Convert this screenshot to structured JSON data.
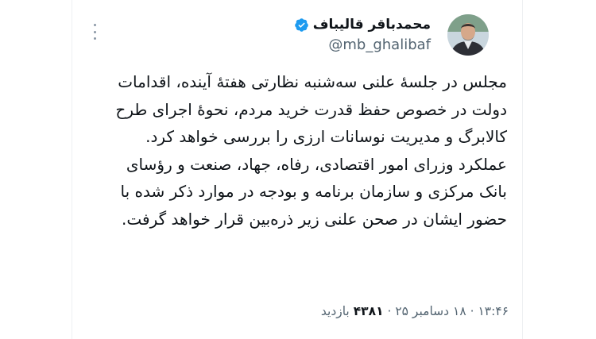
{
  "tweet": {
    "author_name": "محمدباقر قالیباف",
    "author_handle": "@mb_ghalibaf",
    "paragraph_1": "مجلس در جلسهٔ علنی سه‌شنبه نظارتی هفتهٔ آینده، اقدامات دولت در خصوص حفظ قدرت خرید مردم، نحوهٔ اجرای طرح کالابرگ و مدیریت نوسانات ارزی را بررسی خواهد کرد.",
    "paragraph_2": "عملکرد وزرای امور اقتصادی، رفاه، جهاد، صنعت و رؤسای بانک مرکزی و سازمان برنامه و بودجه در موارد ذکر شده با حضور ایشان در صحن علنی زیر ذره‌بین قرار خواهد گرفت.",
    "time": "۱۳:۴۶",
    "date": "۱۸ دسامبر ۲۵",
    "views_count": "۴۳۸۱",
    "views_label": "بازدید",
    "separator": "·"
  },
  "colors": {
    "text": "#0f1419",
    "muted": "#536471",
    "verified": "#1d9bf0"
  },
  "icons": {
    "verified": "verified-badge-icon",
    "more": "more-options-icon"
  }
}
